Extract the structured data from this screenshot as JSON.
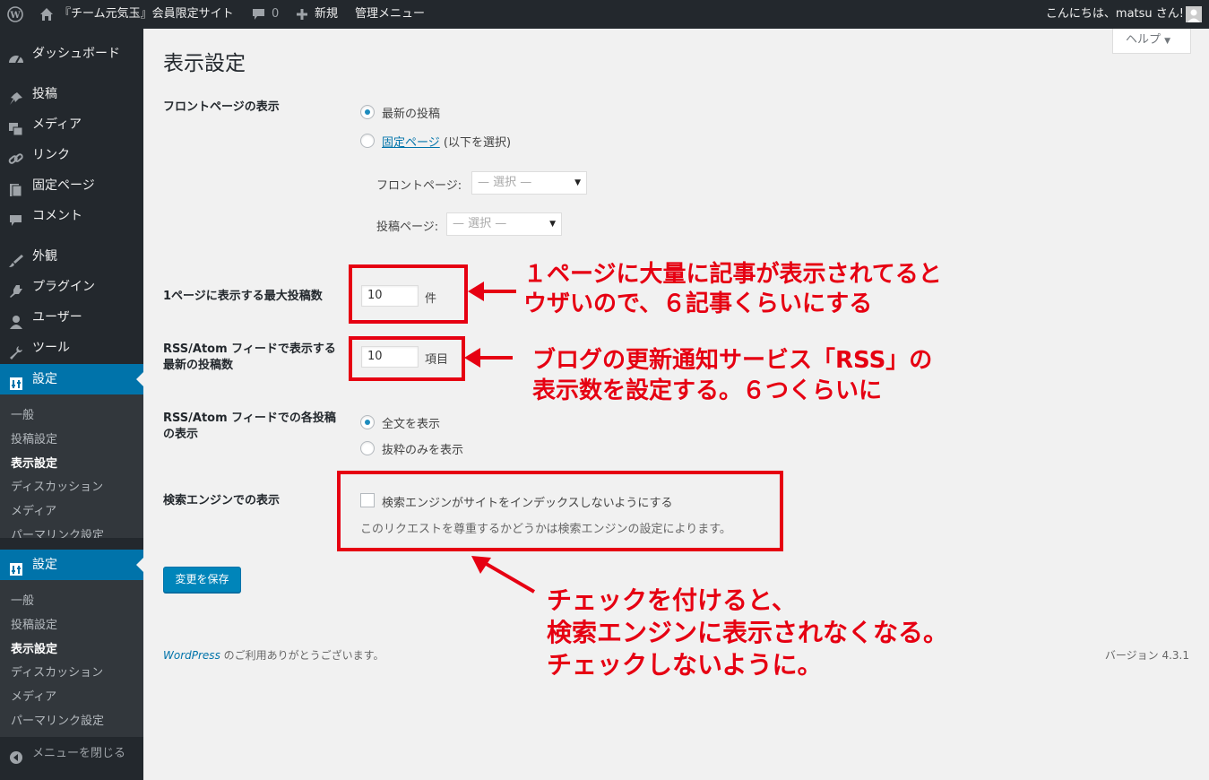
{
  "adminbar": {
    "site_title": "『チーム元気玉』会員限定サイト",
    "comments_count": "0",
    "new_label": "新規",
    "admin_menu": "管理メニュー",
    "greeting": "こんにちは、matsu さん!"
  },
  "sidebar": {
    "items": [
      {
        "label": "ダッシュボード",
        "icon": "dashboard-icon"
      },
      {
        "label": "投稿",
        "icon": "pin-icon"
      },
      {
        "label": "メディア",
        "icon": "media-icon"
      },
      {
        "label": "リンク",
        "icon": "link-icon"
      },
      {
        "label": "固定ページ",
        "icon": "page-icon"
      },
      {
        "label": "コメント",
        "icon": "comment-icon"
      },
      {
        "label": "外観",
        "icon": "brush-icon"
      },
      {
        "label": "プラグイン",
        "icon": "plugin-icon"
      },
      {
        "label": "ユーザー",
        "icon": "user-icon"
      },
      {
        "label": "ツール",
        "icon": "wrench-icon"
      },
      {
        "label": "設定",
        "icon": "settings-icon"
      }
    ],
    "submenu": [
      "一般",
      "投稿設定",
      "表示設定",
      "ディスカッション",
      "メディア",
      "パーマリンク設定"
    ],
    "submenu_clipped": "パーマリンク設定",
    "settings_repeat_label": "設定",
    "collapse_label": "メニューを閉じる"
  },
  "help_label": "ヘルプ",
  "page_title": "表示設定",
  "front_page": {
    "label": "フロントページの表示",
    "option_latest": "最新の投稿",
    "option_static_link": "固定ページ",
    "option_static_suffix": " (以下を選択)",
    "front_label": "フロントページ:",
    "posts_label": "投稿ページ:",
    "select_placeholder": "— 選択 —",
    "selected": "latest"
  },
  "posts_per_page": {
    "label": "1ページに表示する最大投稿数",
    "value": "10",
    "unit": "件"
  },
  "rss_count": {
    "label_line1": "RSS/Atom フィードで表示する",
    "label_line2": "最新の投稿数",
    "value": "10",
    "unit": "項目"
  },
  "rss_display": {
    "label_line1": "RSS/Atom フィードでの各投稿",
    "label_line2": "の表示",
    "option_full": "全文を表示",
    "option_summary": "抜粋のみを表示",
    "selected": "full"
  },
  "search_visibility": {
    "label": "検索エンジンでの表示",
    "checkbox_label": "検索エンジンがサイトをインデックスしないようにする",
    "checked": false,
    "description": "このリクエストを尊重するかどうかは検索エンジンの設定によります。"
  },
  "save_label": "変更を保存",
  "footer": {
    "wp_link": "WordPress",
    "thanks": " のご利用ありがとうございます。",
    "version": "バージョン 4.3.1"
  },
  "annotations": {
    "note1_line1": "１ページに大量に記事が表示されてると",
    "note1_line2": "ウザいので、６記事くらいにする",
    "note2_line1": "ブログの更新通知サービス「RSS」の",
    "note2_line2": "表示数を設定する。６つくらいに",
    "note3_line1": "チェックを付けると、",
    "note3_line2": "検索エンジンに表示されなくなる。",
    "note3_line3": "チェックしないように。",
    "color": "#e60012"
  },
  "colors": {
    "adminbar_bg": "#23282d",
    "menu_active": "#0073aa",
    "primary_button": "#0085ba",
    "annotation": "#e60012"
  }
}
